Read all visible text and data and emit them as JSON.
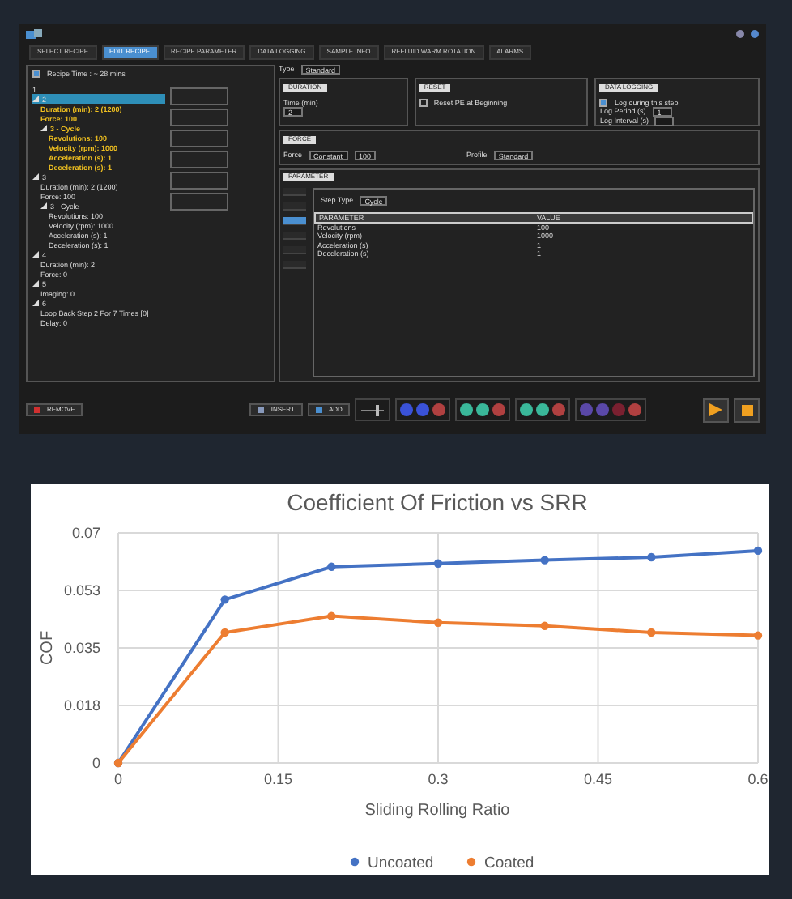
{
  "app": {
    "tabs": [
      {
        "label": "SELECT RECIPE",
        "selected": false
      },
      {
        "label": "EDIT RECIPE",
        "selected": true
      },
      {
        "label": "RECIPE PARAMETER",
        "selected": false
      },
      {
        "label": "DATA LOGGING",
        "selected": false
      },
      {
        "label": "SAMPLE INFO",
        "selected": false
      },
      {
        "label": "REFLUID WARM ROTATION",
        "selected": false
      },
      {
        "label": "ALARMS",
        "selected": false
      }
    ],
    "recipe_time": "Recipe Time : ~ 28 mins",
    "tree": [
      {
        "label": "1",
        "selected": false
      },
      {
        "label": "2",
        "selected": true,
        "expanded": true,
        "children": [
          {
            "label": "Duration (min): 2 (1200)"
          },
          {
            "label": "Force: 100"
          },
          {
            "label": "3 - Cycle",
            "expanded": true,
            "children": [
              {
                "label": "Revolutions: 100"
              },
              {
                "label": "Velocity (rpm): 1000"
              },
              {
                "label": "Acceleration (s): 1"
              },
              {
                "label": "Deceleration (s): 1"
              }
            ]
          }
        ]
      },
      {
        "label": "3",
        "selected": false,
        "expanded": true,
        "children": [
          {
            "label": "Duration (min): 2 (1200)"
          },
          {
            "label": "Force: 100"
          },
          {
            "label": "3 - Cycle",
            "expanded": true,
            "children": [
              {
                "label": "Revolutions: 100"
              },
              {
                "label": "Velocity (rpm): 1000"
              },
              {
                "label": "Acceleration (s): 1"
              },
              {
                "label": "Deceleration (s): 1"
              }
            ]
          }
        ]
      },
      {
        "label": "4",
        "selected": false,
        "expanded": true,
        "children": [
          {
            "label": "Duration (min): 2"
          },
          {
            "label": "Force: 0"
          }
        ]
      },
      {
        "label": "5",
        "selected": false,
        "expanded": true,
        "children": [
          {
            "label": "Imaging: 0"
          }
        ]
      },
      {
        "label": "6",
        "selected": false,
        "expanded": true,
        "children": [
          {
            "label": "Loop Back Step 2 For 7 Times [0]"
          },
          {
            "label": "Delay: 0"
          }
        ]
      }
    ],
    "type_label": "Type",
    "type_value": "Standard",
    "groups": [
      {
        "title": "DURATION",
        "kind": "duration",
        "field_label": "Time (min)",
        "field_value": "2"
      },
      {
        "title": "RESET",
        "kind": "reset",
        "checkbox_label": "Reset PE at Beginning",
        "checked": false
      },
      {
        "title": "DATA LOGGING",
        "kind": "logging",
        "checkbox_label": "Log during this step",
        "checked": true,
        "fields": [
          {
            "label": "Log Period (s)",
            "value": "1"
          },
          {
            "label": "Log Interval (s)"
          }
        ]
      }
    ],
    "force_title": "FORCE",
    "force_label": "Force",
    "force_mode": "Constant",
    "force_value": "100",
    "profile_label": "Profile",
    "profile_value": "Standard",
    "parameter_title": "PARAMETER",
    "side_tabs": [
      {
        "selected": false
      },
      {
        "selected": false
      },
      {
        "selected": true
      },
      {
        "selected": false
      },
      {
        "selected": false
      },
      {
        "selected": false
      }
    ],
    "step_type_label": "Step Type",
    "step_type": "Cycle",
    "table": {
      "columns": [
        "PARAMETER",
        "VALUE"
      ],
      "rows": [
        [
          "Revolutions",
          "100"
        ],
        [
          "Velocity (rpm)",
          "1000"
        ],
        [
          "Acceleration (s)",
          "1"
        ],
        [
          "Deceleration (s)",
          "1"
        ]
      ]
    },
    "buttons": [
      {
        "label": "REMOVE",
        "kind": "remove"
      },
      {
        "label": "INSERT",
        "kind": "insert"
      },
      {
        "label": "ADD",
        "kind": "add"
      }
    ],
    "slider": {
      "level": 0.6
    },
    "tool_groups": [
      {
        "circles": [
          {
            "color": "#3a52d8"
          },
          {
            "color": "#3a52d8"
          },
          {
            "color": "#b04040"
          }
        ]
      },
      {
        "circles": [
          {
            "color": "#3ab89a"
          },
          {
            "color": "#3ab89a"
          },
          {
            "color": "#b04040"
          }
        ]
      },
      {
        "circles": [
          {
            "color": "#3ab89a"
          },
          {
            "color": "#3ab89a"
          },
          {
            "color": "#b04040"
          }
        ]
      },
      {
        "circles": [
          {
            "color": "#5a48a8"
          },
          {
            "color": "#5a48a8"
          },
          {
            "color": "#7a2030"
          },
          {
            "color": "#b04040"
          }
        ]
      }
    ]
  },
  "chart": {
    "chart_data": {
      "type": "line",
      "title": "Coefficient Of Friction  vs SRR",
      "xlabel": "Sliding Rolling Ratio",
      "ylabel": "COF",
      "x": [
        0,
        0.1,
        0.2,
        0.3,
        0.4,
        0.5,
        0.6
      ],
      "series": [
        {
          "name": "Uncoated",
          "color": "#4472c4",
          "marker": "circle",
          "values": [
            0,
            0.0497,
            0.0597,
            0.0607,
            0.0617,
            0.0626,
            0.0646
          ]
        },
        {
          "name": "Coated",
          "color": "#ed7d31",
          "marker": "circle",
          "values": [
            0,
            0.0397,
            0.0447,
            0.0427,
            0.0417,
            0.0397,
            0.0388
          ]
        }
      ],
      "grid": true,
      "legend": true,
      "xlim": [
        0,
        0.6
      ],
      "ylim": [
        0,
        0.07
      ],
      "xticks": [
        0,
        0.15,
        0.3,
        0.45,
        0.6
      ],
      "yticks": [
        0,
        {
          "value": 0.0175,
          "label": "0.018"
        },
        0.035,
        {
          "value": 0.0525,
          "label": "0.053"
        },
        0.07
      ]
    }
  }
}
